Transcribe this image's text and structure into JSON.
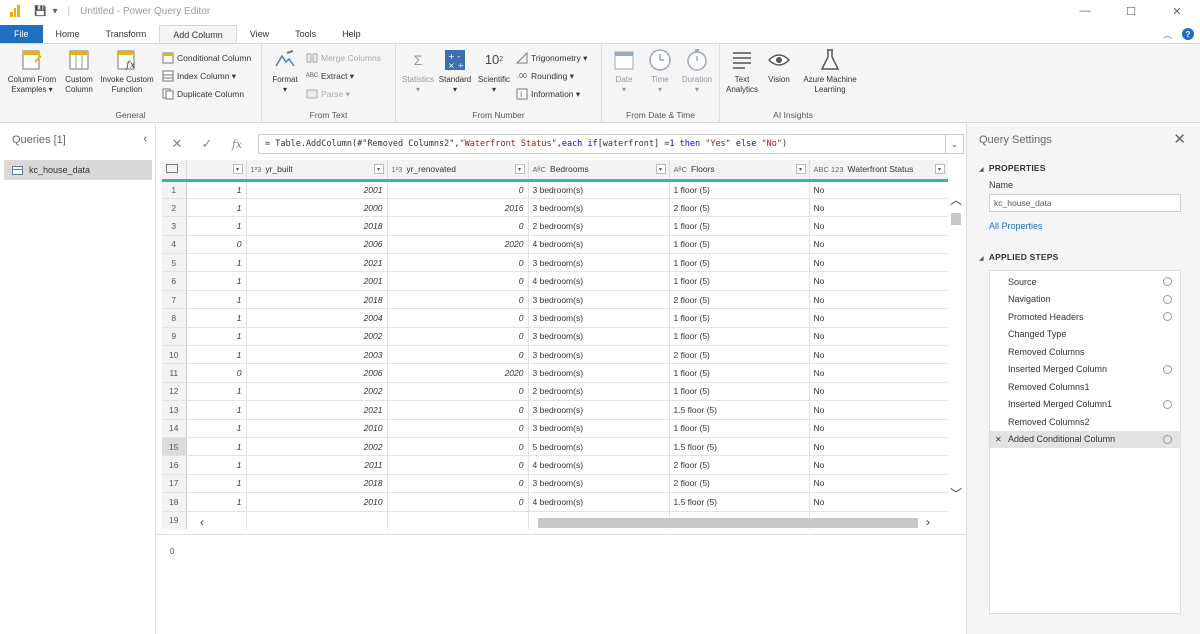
{
  "window": {
    "title": "Untitled - Power Query Editor",
    "controls": [
      "—",
      "☐",
      "✕"
    ]
  },
  "tabs": [
    {
      "label": "File"
    },
    {
      "label": "Home"
    },
    {
      "label": "Transform"
    },
    {
      "label": "Add Column"
    },
    {
      "label": "View"
    },
    {
      "label": "Tools"
    },
    {
      "label": "Help"
    }
  ],
  "ribbon": {
    "general": {
      "label": "General",
      "column_from_examples": "Column From\nExamples ▾",
      "custom_column": "Custom\nColumn",
      "invoke_custom_function": "Invoke Custom\nFunction",
      "conditional_column": "Conditional Column",
      "index_column": "Index Column ▾",
      "duplicate_column": "Duplicate Column"
    },
    "from_text": {
      "label": "From Text",
      "format": "Format\n▾",
      "merge_columns": "Merge Columns",
      "extract": "Extract ▾",
      "parse": "Parse ▾"
    },
    "from_number": {
      "label": "From Number",
      "statistics": "Statistics\n▾",
      "standard": "Standard\n▾",
      "scientific": "Scientific\n▾",
      "trigonometry": "Trigonometry ▾",
      "rounding": "Rounding ▾",
      "information": "Information ▾"
    },
    "from_date_time": {
      "label": "From Date & Time",
      "date": "Date\n▾",
      "time": "Time\n▾",
      "duration": "Duration\n▾"
    },
    "ai_insights": {
      "label": "AI Insights",
      "text_analytics": "Text\nAnalytics",
      "vision": "Vision",
      "azure_ml": "Azure Machine\nLearning"
    }
  },
  "queries": {
    "header": "Queries [1]",
    "items": [
      {
        "name": "kc_house_data"
      }
    ]
  },
  "formula": {
    "prefix": "= Table.AddColumn(#\"Removed Columns2\", ",
    "str1": "\"Waterfront Status\"",
    "mid1": ", ",
    "kw_each": "each",
    "kw_if": "if",
    "mid2": " [waterfront] = ",
    "num": "1",
    "kw_then": "then",
    "str2": "\"Yes\"",
    "kw_else": "else",
    "str3": "\"No\"",
    "suffix": ")"
  },
  "table": {
    "columns": [
      {
        "type": "",
        "name": ""
      },
      {
        "type": "1²3",
        "name": "yr_built"
      },
      {
        "type": "1²3",
        "name": "yr_renovated"
      },
      {
        "type": "AᴮC",
        "name": "Bedrooms"
      },
      {
        "type": "AᴮC",
        "name": "Floors"
      },
      {
        "type": "ABC 123",
        "name": "Waterfront Status"
      }
    ],
    "rows": [
      [
        "1",
        "1",
        "2001",
        "0",
        "3 bedroom(s)",
        "1 floor (5)",
        "No"
      ],
      [
        "2",
        "1",
        "2000",
        "2016",
        "3 bedroom(s)",
        "2 floor (5)",
        "No"
      ],
      [
        "3",
        "1",
        "2018",
        "0",
        "2 bedroom(s)",
        "1 floor (5)",
        "No"
      ],
      [
        "4",
        "0",
        "2006",
        "2020",
        "4 bedroom(s)",
        "1 floor (5)",
        "No"
      ],
      [
        "5",
        "1",
        "2021",
        "0",
        "3 bedroom(s)",
        "1 floor (5)",
        "No"
      ],
      [
        "6",
        "1",
        "2001",
        "0",
        "4 bedroom(s)",
        "1 floor (5)",
        "No"
      ],
      [
        "7",
        "1",
        "2018",
        "0",
        "3 bedroom(s)",
        "2 floor (5)",
        "No"
      ],
      [
        "8",
        "1",
        "2004",
        "0",
        "3 bedroom(s)",
        "1 floor (5)",
        "No"
      ],
      [
        "9",
        "1",
        "2002",
        "0",
        "3 bedroom(s)",
        "1 floor (5)",
        "No"
      ],
      [
        "10",
        "1",
        "2003",
        "0",
        "3 bedroom(s)",
        "2 floor (5)",
        "No"
      ],
      [
        "11",
        "0",
        "2006",
        "2020",
        "3 bedroom(s)",
        "1 floor (5)",
        "No"
      ],
      [
        "12",
        "1",
        "2002",
        "0",
        "2 bedroom(s)",
        "1 floor (5)",
        "No"
      ],
      [
        "13",
        "1",
        "2021",
        "0",
        "3 bedroom(s)",
        "1.5 floor (5)",
        "No"
      ],
      [
        "14",
        "1",
        "2010",
        "0",
        "3 bedroom(s)",
        "1 floor (5)",
        "No"
      ],
      [
        "15",
        "1",
        "2002",
        "0",
        "5 bedroom(s)",
        "1.5 floor (5)",
        "No"
      ],
      [
        "16",
        "1",
        "2011",
        "0",
        "4 bedroom(s)",
        "2 floor (5)",
        "No"
      ],
      [
        "17",
        "1",
        "2018",
        "0",
        "3 bedroom(s)",
        "2 floor (5)",
        "No"
      ],
      [
        "18",
        "1",
        "2010",
        "0",
        "4 bedroom(s)",
        "1.5 floor (5)",
        "No"
      ],
      [
        "19",
        "",
        "",
        "",
        "",
        "",
        ""
      ]
    ],
    "selected_row": 15
  },
  "footer_zero": "0",
  "settings": {
    "header": "Query Settings",
    "properties_label": "PROPERTIES",
    "name_label": "Name",
    "name_value": "kc_house_data",
    "all_properties": "All Properties",
    "applied_steps_label": "APPLIED STEPS",
    "steps": [
      {
        "name": "Source",
        "gear": true
      },
      {
        "name": "Navigation",
        "gear": true
      },
      {
        "name": "Promoted Headers",
        "gear": true
      },
      {
        "name": "Changed Type",
        "gear": false
      },
      {
        "name": "Removed Columns",
        "gear": false
      },
      {
        "name": "Inserted Merged Column",
        "gear": true
      },
      {
        "name": "Removed Columns1",
        "gear": false
      },
      {
        "name": "Inserted Merged Column1",
        "gear": true
      },
      {
        "name": "Removed Columns2",
        "gear": false
      },
      {
        "name": "Added Conditional Column",
        "gear": true,
        "active": true
      }
    ]
  },
  "colors": {
    "accent": "#1e6fc2",
    "header_underline": "#3db3a1",
    "ribbon_bg": "#f5f5f5"
  }
}
